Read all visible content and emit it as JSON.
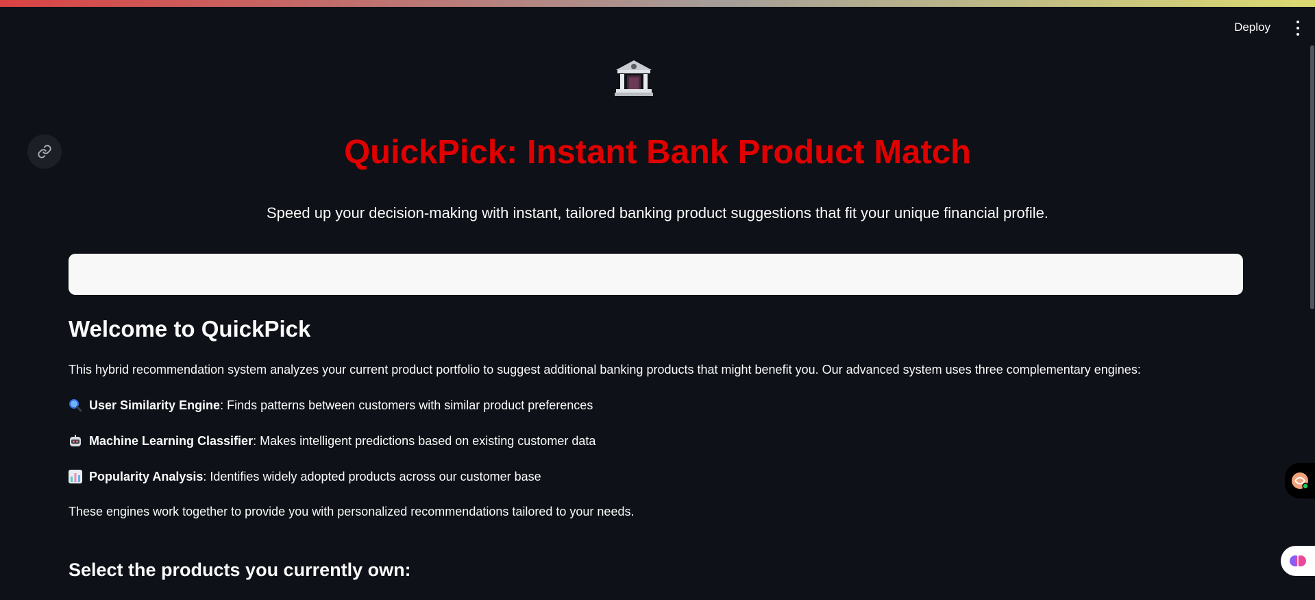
{
  "header": {
    "deploy_label": "Deploy",
    "menu_icon": "more-vertical-icon"
  },
  "hero": {
    "icon": "bank-icon",
    "title": "QuickPick: Instant Bank Product Match",
    "subtitle": "Speed up your decision-making with instant, tailored banking product suggestions that fit your unique financial profile.",
    "title_color": "#e00000"
  },
  "search": {
    "value": "",
    "placeholder": ""
  },
  "welcome": {
    "heading": "Welcome to QuickPick",
    "intro": "This hybrid recommendation system analyzes your current product portfolio to suggest additional banking products that might benefit you. Our advanced system uses three complementary engines:",
    "engines": [
      {
        "icon": "magnifier-icon",
        "name": "User Similarity Engine",
        "description": ": Finds patterns between customers with similar product preferences"
      },
      {
        "icon": "robot-icon",
        "name": "Machine Learning Classifier",
        "description": ": Makes intelligent predictions based on existing customer data"
      },
      {
        "icon": "bar-chart-icon",
        "name": "Popularity Analysis",
        "description": ": Identifies widely adopted products across our customer base"
      }
    ],
    "summary": "These engines work together to provide you with personalized recommendations tailored to your needs."
  },
  "products": {
    "heading": "Select the products you currently own:"
  },
  "colors": {
    "background": "#0e1117",
    "text": "#fafafa",
    "accent_red": "#e00000"
  }
}
